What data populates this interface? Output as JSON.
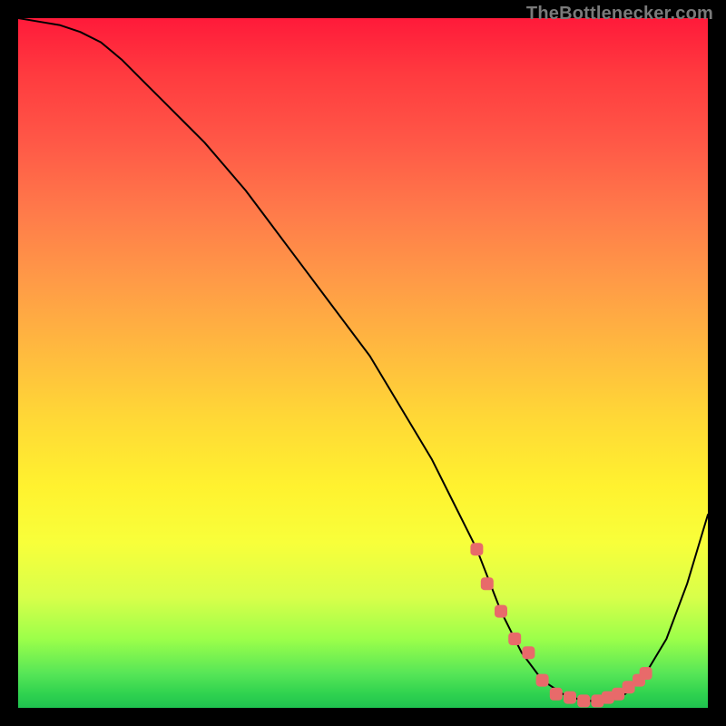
{
  "watermark": "TheBottlenecker.com",
  "chart_data": {
    "type": "line",
    "title": "",
    "xlabel": "",
    "ylabel": "",
    "xlim": [
      0,
      100
    ],
    "ylim": [
      0,
      100
    ],
    "grid": false,
    "series": [
      {
        "name": "curve",
        "x": [
          0,
          3,
          6,
          9,
          12,
          15,
          18,
          21,
          24,
          27,
          30,
          33,
          36,
          39,
          42,
          45,
          48,
          51,
          54,
          57,
          60,
          63,
          66.5,
          70,
          73,
          76,
          79,
          82,
          85,
          88,
          91,
          94,
          97,
          100
        ],
        "values": [
          100,
          99.5,
          99,
          98,
          96.5,
          94,
          91,
          88,
          85,
          82,
          78.5,
          75,
          71,
          67,
          63,
          59,
          55,
          51,
          46,
          41,
          36,
          30,
          23,
          14,
          8,
          4,
          2,
          1,
          1,
          2,
          5,
          10,
          18,
          28
        ]
      }
    ],
    "markers": {
      "name": "highlight",
      "x": [
        66.5,
        68,
        70,
        72,
        74,
        76,
        78,
        80,
        82,
        84,
        85.5,
        87,
        88.5,
        90,
        91
      ],
      "values": [
        23,
        18,
        14,
        10,
        8,
        4,
        2,
        1.5,
        1,
        1,
        1.5,
        2,
        3,
        4,
        5
      ]
    },
    "colors": {
      "curve": "#000000",
      "markers": "#e86a6a",
      "background_gradient": [
        "#ff1a3a",
        "#ff9a47",
        "#fff22f",
        "#1fc24f"
      ]
    }
  }
}
